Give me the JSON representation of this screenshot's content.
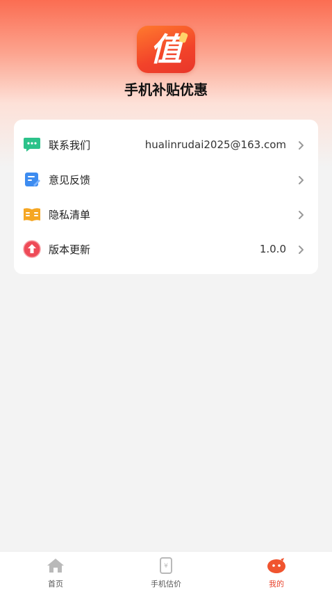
{
  "app": {
    "name": "手机补贴优惠",
    "logo_char": "值"
  },
  "menu": [
    {
      "label": "联系我们",
      "value": "hualinrudai2025@163.com",
      "icon": "chat-icon",
      "color": "#2cc28a"
    },
    {
      "label": "意见反馈",
      "value": "",
      "icon": "edit-icon",
      "color": "#3d8cf0"
    },
    {
      "label": "隐私清单",
      "value": "",
      "icon": "book-icon",
      "color": "#f5a623"
    },
    {
      "label": "版本更新",
      "value": "1.0.0",
      "icon": "upload-icon",
      "color": "#ee4b58"
    }
  ],
  "tabs": [
    {
      "label": "首页",
      "icon": "home-icon",
      "active": false
    },
    {
      "label": "手机估价",
      "icon": "phone-price-icon",
      "active": false
    },
    {
      "label": "我的",
      "icon": "profile-icon",
      "active": true
    }
  ],
  "colors": {
    "accent": "#e8432c",
    "header_top": "#fb6d52"
  }
}
